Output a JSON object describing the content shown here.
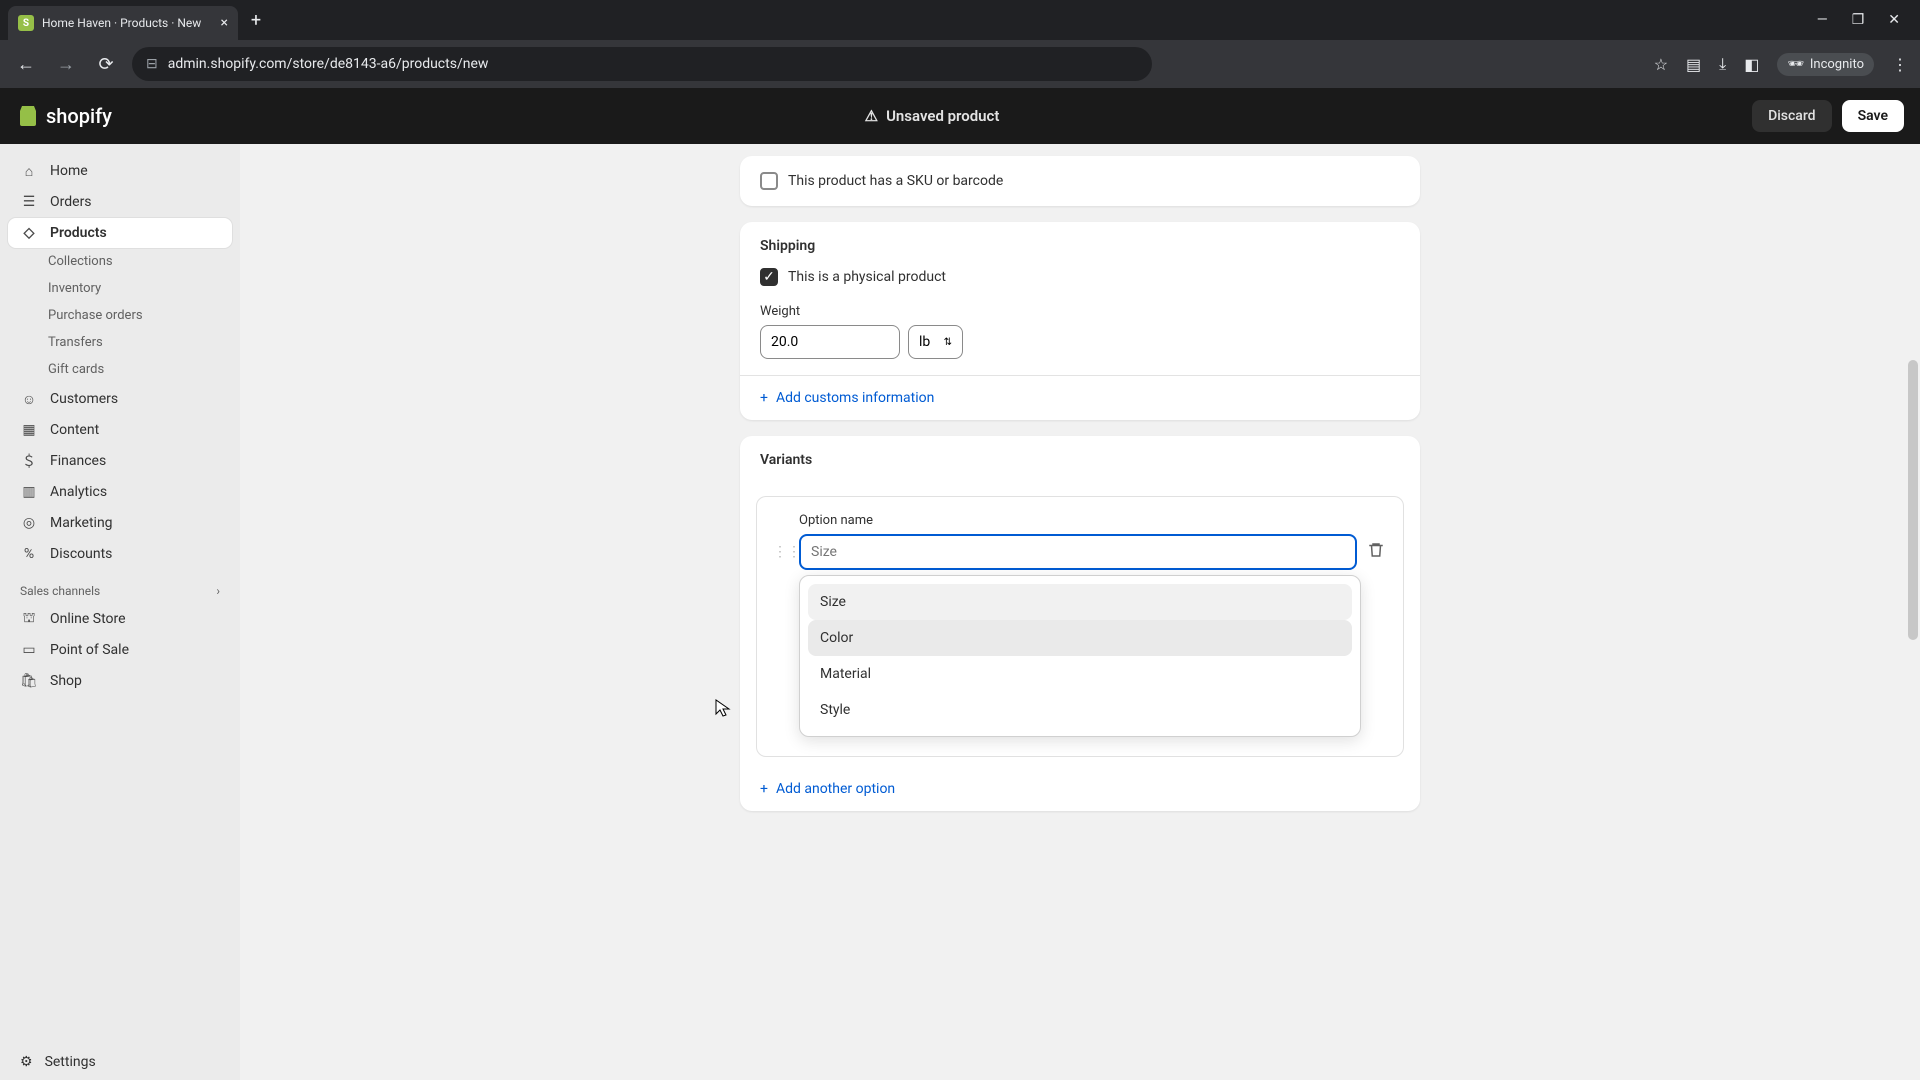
{
  "browser": {
    "tab_title": "Home Haven · Products · New",
    "url": "admin.shopify.com/store/de8143-a6/products/new",
    "incognito_label": "Incognito"
  },
  "topbar": {
    "logo_text": "shopify",
    "unsaved_label": "Unsaved product",
    "discard_label": "Discard",
    "save_label": "Save"
  },
  "sidebar": {
    "items": [
      {
        "label": "Home"
      },
      {
        "label": "Orders"
      },
      {
        "label": "Products"
      }
    ],
    "products_sub": [
      {
        "label": "Collections"
      },
      {
        "label": "Inventory"
      },
      {
        "label": "Purchase orders"
      },
      {
        "label": "Transfers"
      },
      {
        "label": "Gift cards"
      }
    ],
    "rest": [
      {
        "label": "Customers"
      },
      {
        "label": "Content"
      },
      {
        "label": "Finances"
      },
      {
        "label": "Analytics"
      },
      {
        "label": "Marketing"
      },
      {
        "label": "Discounts"
      }
    ],
    "section_label": "Sales channels",
    "channels": [
      {
        "label": "Online Store"
      },
      {
        "label": "Point of Sale"
      },
      {
        "label": "Shop"
      }
    ],
    "settings_label": "Settings"
  },
  "sku": {
    "checkbox_label": "This product has a SKU or barcode"
  },
  "shipping": {
    "title": "Shipping",
    "physical_label": "This is a physical product",
    "weight_label": "Weight",
    "weight_value": "20.0",
    "weight_unit": "lb",
    "customs_link": "Add customs information"
  },
  "variants": {
    "title": "Variants",
    "option_label": "Option name",
    "option_placeholder": "Size",
    "dropdown": [
      "Size",
      "Color",
      "Material",
      "Style"
    ],
    "add_option_label": "Add another option"
  }
}
